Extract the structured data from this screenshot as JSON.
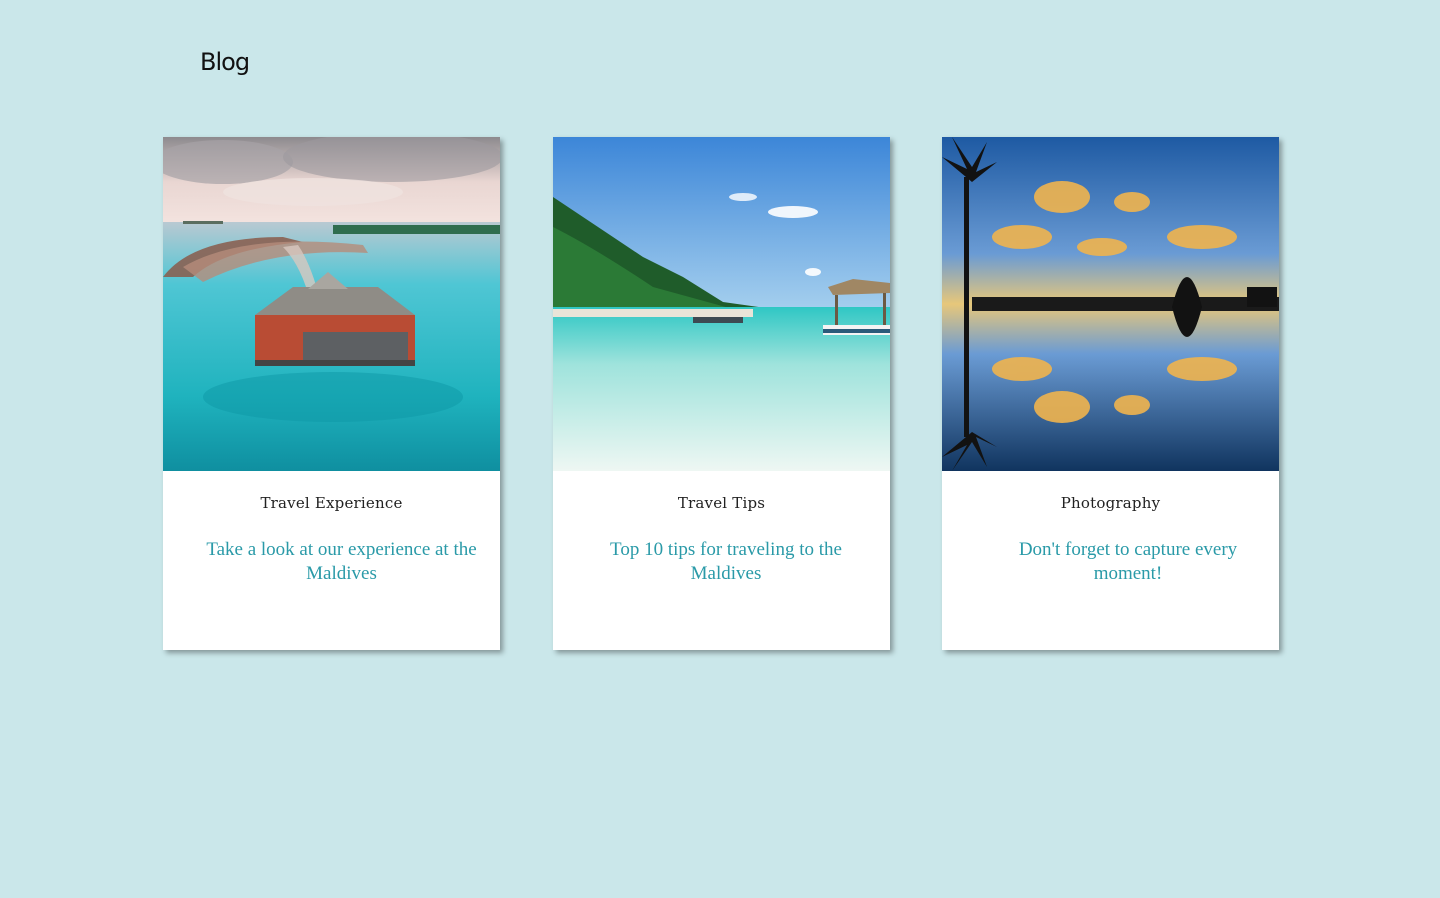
{
  "page": {
    "title": "Blog",
    "background": "#cae7ea",
    "accent": "#2a9aa8"
  },
  "posts": [
    {
      "category": "Travel Experience",
      "headline": "Take a look at our experience at the Maldives",
      "image_icon": "maldives-overwater-resort-photo"
    },
    {
      "category": "Travel Tips",
      "headline": "Top 10 tips for traveling to the Maldives",
      "image_icon": "tropical-beach-photo"
    },
    {
      "category": "Photography",
      "headline": "Don't forget to capture every moment!",
      "image_icon": "sunset-reflection-photo"
    }
  ]
}
